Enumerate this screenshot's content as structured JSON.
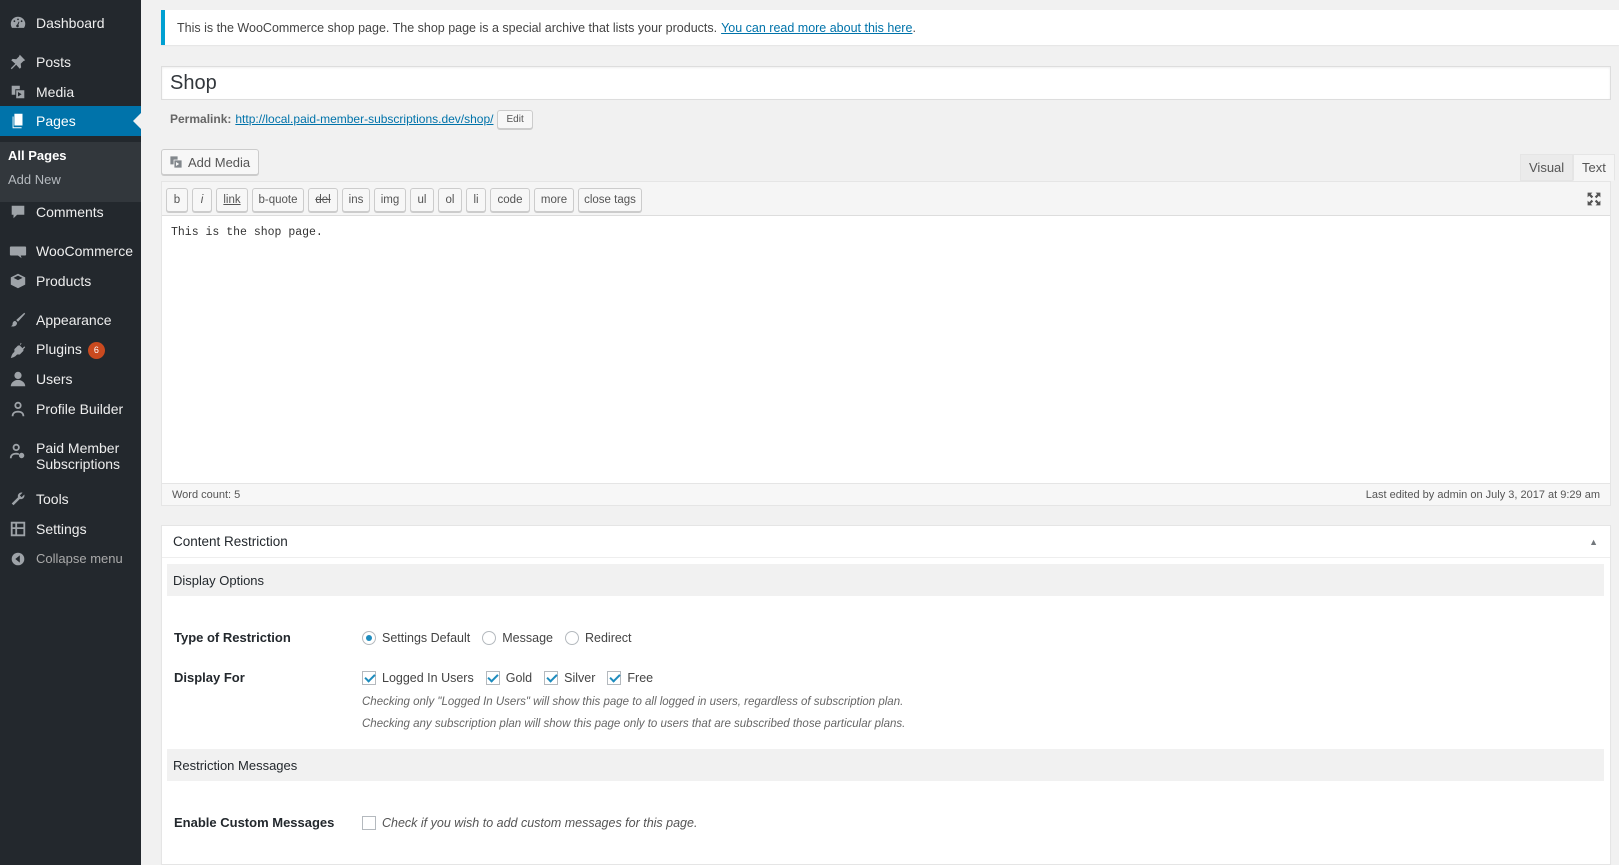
{
  "sidebar": {
    "items": [
      {
        "label": "Dashboard",
        "icon": "dashboard-icon"
      },
      {
        "label": "Posts",
        "icon": "pin-icon"
      },
      {
        "label": "Media",
        "icon": "media-icon"
      },
      {
        "label": "Pages",
        "icon": "pages-icon"
      },
      {
        "label": "Comments",
        "icon": "comment-icon"
      },
      {
        "label": "WooCommerce",
        "icon": "woocommerce-icon"
      },
      {
        "label": "Products",
        "icon": "products-icon"
      },
      {
        "label": "Appearance",
        "icon": "brush-icon"
      },
      {
        "label": "Plugins",
        "icon": "plugin-icon"
      },
      {
        "label": "Users",
        "icon": "users-icon"
      },
      {
        "label": "Profile Builder",
        "icon": "profile-icon"
      },
      {
        "label": "Paid Member Subscriptions",
        "icon": "member-icon"
      },
      {
        "label": "Tools",
        "icon": "wrench-icon"
      },
      {
        "label": "Settings",
        "icon": "settings-icon"
      },
      {
        "label": "Collapse menu",
        "icon": "collapse-icon"
      }
    ],
    "plugins_badge": "6",
    "submenu": {
      "all_pages": "All Pages",
      "add_new": "Add New"
    },
    "accent_color": "#0073aa"
  },
  "notice": {
    "text": "This is the WooCommerce shop page. The shop page is a special archive that lists your products.",
    "link_text": "You can read more about this here",
    "link_suffix": "."
  },
  "post": {
    "title": "Shop",
    "permalink_label": "Permalink:",
    "permalink_url": "http://local.paid-member-subscriptions.dev/shop/",
    "edit_label": "Edit"
  },
  "editor": {
    "add_media_label": "Add Media",
    "tabs": {
      "visual": "Visual",
      "text": "Text"
    },
    "quicktags": [
      "b",
      "i",
      "link",
      "b-quote",
      "del",
      "ins",
      "img",
      "ul",
      "ol",
      "li",
      "code",
      "more",
      "close tags"
    ],
    "content": "This is the shop page.",
    "word_count": "Word count: 5",
    "last_edited": "Last edited by admin on July 3, 2017 at 9:29 am"
  },
  "restriction": {
    "title": "Content Restriction",
    "display_options_heading": "Display Options",
    "type_label": "Type of Restriction",
    "types": [
      {
        "label": "Settings Default",
        "checked": true
      },
      {
        "label": "Message",
        "checked": false
      },
      {
        "label": "Redirect",
        "checked": false
      }
    ],
    "display_for_label": "Display For",
    "display_for": [
      {
        "label": "Logged In Users",
        "checked": true
      },
      {
        "label": "Gold",
        "checked": true
      },
      {
        "label": "Silver",
        "checked": true
      },
      {
        "label": "Free",
        "checked": true
      }
    ],
    "desc1": "Checking only \"Logged In Users\" will show this page to all logged in users, regardless of subscription plan.",
    "desc2": "Checking any subscription plan will show this page only to users that are subscribed those particular plans.",
    "messages_heading": "Restriction Messages",
    "custom_messages_label": "Enable Custom Messages",
    "custom_messages_text": "Check if you wish to add custom messages for this page.",
    "custom_messages_checked": false
  }
}
